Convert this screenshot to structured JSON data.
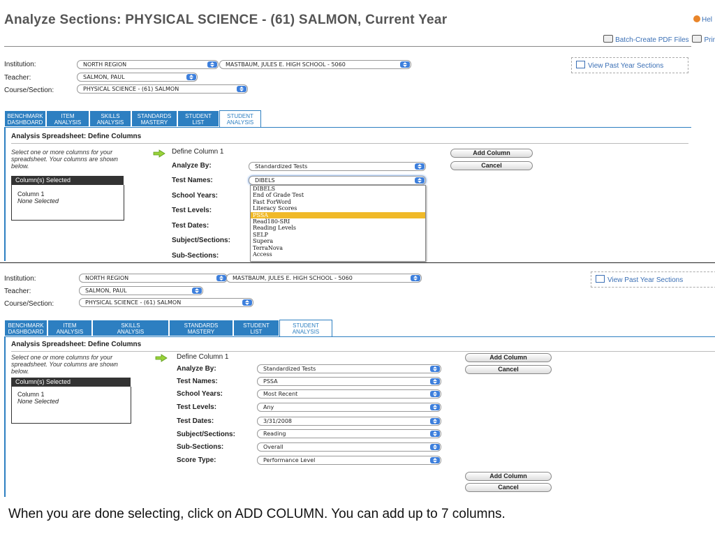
{
  "header": {
    "title": "Analyze Sections: PHYSICAL SCIENCE - (61) SALMON, Current Year",
    "help_label": "Hel",
    "batch_pdf_label": "Batch-Create PDF Files",
    "print_label": "Prir"
  },
  "filters": {
    "institution_label": "Institution:",
    "teacher_label": "Teacher:",
    "course_label": "Course/Section:",
    "institution_value": "NORTH REGION",
    "school_value": "MASTBAUM, JULES E. HIGH SCHOOL - 5060",
    "teacher_value": "SALMON, PAUL",
    "course_value": "PHYSICAL SCIENCE - (61) SALMON",
    "view_past_label": "View Past Year Sections"
  },
  "tabs": [
    {
      "line1": "BENCHMARK",
      "line2": "DASHBOARD"
    },
    {
      "line1": "ITEM",
      "line2": "ANALYSIS"
    },
    {
      "line1": "SKILLS",
      "line2": "ANALYSIS"
    },
    {
      "line1": "STANDARDS",
      "line2": "MASTERY"
    },
    {
      "line1": "STUDENT",
      "line2": "LIST"
    },
    {
      "line1": "STUDENT",
      "line2": "ANALYSIS"
    }
  ],
  "spreadsheet": {
    "heading": "Analysis Spreadsheet: Define Columns",
    "hint": "Select one or more columns for your spreadsheet. Your columns are shown below.",
    "selected_header": "Column(s) Selected",
    "selected_col": "Column 1",
    "selected_none": "None Selected",
    "define_label": "Define Column 1",
    "add_column": "Add Column",
    "cancel": "Cancel"
  },
  "fields": {
    "analyze_by": "Analyze By:",
    "test_names": "Test Names:",
    "school_years": "School Years:",
    "test_levels": "Test Levels:",
    "test_dates": "Test Dates:",
    "subject_sections": "Subject/Sections:",
    "sub_sections": "Sub-Sections:",
    "score_type": "Score Type:"
  },
  "top_panel": {
    "analyze_by_value": "Standardized Tests",
    "test_names_value": "DIBELS",
    "dropdown_options": [
      "DIBELS",
      "End of Grade Test",
      "Fast ForWord",
      "Literacy Scores",
      "PSSA",
      "Read180-SRI",
      "Reading Levels",
      "SELP",
      "Supera",
      "TerraNova",
      "Access"
    ],
    "highlighted_option": "PSSA"
  },
  "bottom_panel": {
    "analyze_by_value": "Standardized Tests",
    "test_names_value": "PSSA",
    "school_years_value": "Most Recent",
    "test_levels_value": "Any",
    "test_dates_value": "3/31/2008",
    "subject_sections_value": "Reading",
    "sub_sections_value": "Overall",
    "score_type_value": "Performance Level"
  },
  "caption": "When you are done selecting, click on ADD COLUMN. You can add up to 7 columns.",
  "colors": {
    "tab_blue": "#2d7fc1",
    "select_arrow": "#3d7fdc",
    "highlight": "#f0b928",
    "link": "#3a6fb5"
  }
}
